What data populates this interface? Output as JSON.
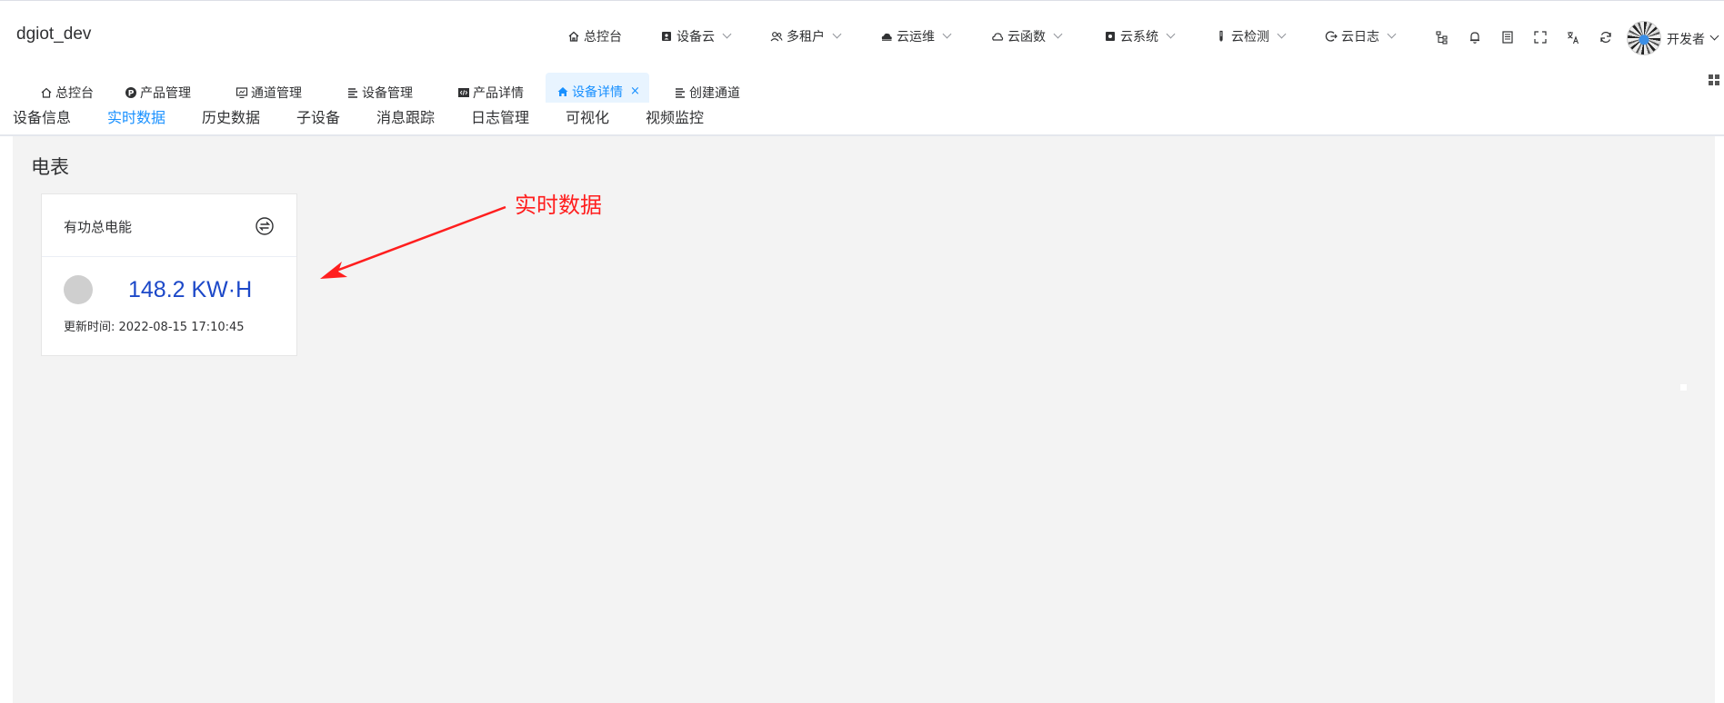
{
  "app": {
    "brand": "dgiot_dev"
  },
  "nav": [
    {
      "label": "总控台",
      "icon": "home-icon",
      "chevron": false
    },
    {
      "label": "设备云",
      "icon": "contact-card-icon",
      "chevron": true
    },
    {
      "label": "多租户",
      "icon": "users-icon",
      "chevron": true
    },
    {
      "label": "云运维",
      "icon": "cloud-solid-icon",
      "chevron": true
    },
    {
      "label": "云函数",
      "icon": "cloud-outline-icon",
      "chevron": true
    },
    {
      "label": "云系统",
      "icon": "system-icon",
      "chevron": true
    },
    {
      "label": "云检测",
      "icon": "test-tube-icon",
      "chevron": true
    },
    {
      "label": "云日志",
      "icon": "logout-icon",
      "chevron": true
    }
  ],
  "toolbar_icons": [
    "sitemap-icon",
    "bell-icon",
    "document-icon",
    "fullscreen-icon",
    "translate-icon",
    "refresh-icon"
  ],
  "user": {
    "name": "开发者"
  },
  "tags": [
    {
      "label": "总控台",
      "icon": "home-icon",
      "active": false
    },
    {
      "label": "产品管理",
      "icon": "product-icon",
      "active": false
    },
    {
      "label": "通道管理",
      "icon": "monitor-icon",
      "active": false
    },
    {
      "label": "设备管理",
      "icon": "list-icon",
      "active": false
    },
    {
      "label": "产品详情",
      "icon": "code-icon",
      "active": false
    },
    {
      "label": "设备详情",
      "icon": "home-icon",
      "active": true,
      "close": "×"
    },
    {
      "label": "创建通道",
      "icon": "list-icon",
      "active": false
    }
  ],
  "subtabs": [
    {
      "label": "设备信息",
      "active": false
    },
    {
      "label": "实时数据",
      "active": true
    },
    {
      "label": "历史数据",
      "active": false
    },
    {
      "label": "子设备",
      "active": false
    },
    {
      "label": "消息跟踪",
      "active": false
    },
    {
      "label": "日志管理",
      "active": false
    },
    {
      "label": "可视化",
      "active": false
    },
    {
      "label": "视频监控",
      "active": false
    }
  ],
  "main": {
    "section_title": "电表",
    "card": {
      "title": "有功总电能",
      "value": "148.2 KW·H",
      "updated_label": "更新时间: 2022-08-15 17:10:45"
    },
    "annotation": "实时数据"
  },
  "colors": {
    "accent": "#1890ff",
    "value": "#1c48c8",
    "annotation": "#ff1e1e",
    "content_bg": "#f3f3f3"
  }
}
